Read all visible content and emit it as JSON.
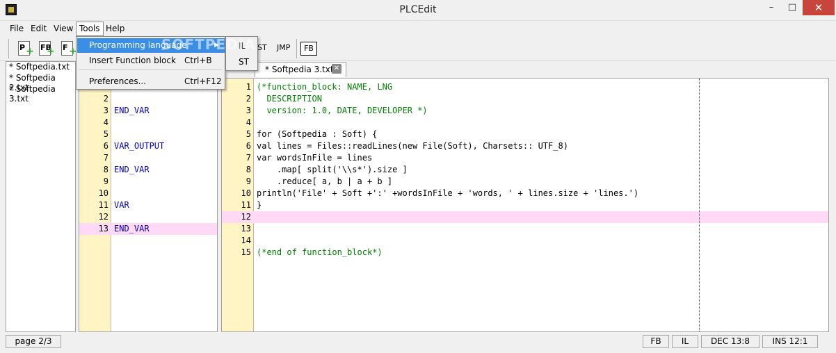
{
  "window": {
    "title": "PLCEdit",
    "minimize": "–",
    "maximize": "□",
    "close": "✕"
  },
  "menubar": {
    "file": "File",
    "edit": "Edit",
    "view": "View",
    "tools": "Tools",
    "help": "Help"
  },
  "toolbar": {
    "buttons": [
      {
        "label": "P",
        "icon": "new-program-icon"
      },
      {
        "label": "FB",
        "icon": "new-function-block-icon"
      },
      {
        "label": "F",
        "icon": "new-function-icon"
      }
    ],
    "st_label": "ST",
    "jmp_label": "JMP",
    "fb_label": "FB"
  },
  "tools_menu": {
    "programming_language": "Programming language",
    "insert_function_block": "Insert Function block",
    "insert_shortcut": "Ctrl+B",
    "preferences": "Preferences...",
    "preferences_shortcut": "Ctrl+F12",
    "submenu": [
      "IL",
      "ST"
    ]
  },
  "watermark": "SOFTPEDIA",
  "files": [
    "* Softpedia.txt",
    "* Softpedia 2.txt",
    "* Softpedia 3.txt"
  ],
  "tab": {
    "label": "* Softpedia 3.txt",
    "close": "✕"
  },
  "left_editor": {
    "lines": [
      {
        "n": "2",
        "text": "",
        "cls": "kw"
      },
      {
        "n": "3",
        "text": "END_VAR",
        "cls": "kw"
      },
      {
        "n": "4",
        "text": "",
        "cls": "kw"
      },
      {
        "n": "5",
        "text": "",
        "cls": "kw"
      },
      {
        "n": "6",
        "text": "VAR_OUTPUT",
        "cls": "kw"
      },
      {
        "n": "7",
        "text": "",
        "cls": "kw"
      },
      {
        "n": "8",
        "text": "END_VAR",
        "cls": "kw"
      },
      {
        "n": "9",
        "text": "",
        "cls": "kw"
      },
      {
        "n": "10",
        "text": "",
        "cls": "kw"
      },
      {
        "n": "11",
        "text": "VAR",
        "cls": "kw"
      },
      {
        "n": "12",
        "text": "",
        "cls": "kw"
      },
      {
        "n": "13",
        "text": "END_VAR",
        "cls": "kw",
        "highlight": true
      }
    ]
  },
  "right_editor": {
    "lines": [
      {
        "n": "1",
        "text": "(*function_block: NAME, LNG",
        "cls": "cm"
      },
      {
        "n": "2",
        "text": "  DESCRIPTION",
        "cls": "cm"
      },
      {
        "n": "3",
        "text": "  version: 1.0, DATE, DEVELOPER *)",
        "cls": "cm"
      },
      {
        "n": "4",
        "text": "",
        "cls": ""
      },
      {
        "n": "5",
        "text": "for (Softpedia : Soft) {",
        "cls": ""
      },
      {
        "n": "6",
        "text": "val lines = Files::readLines(new File(Soft), Charsets:: UTF_8)",
        "cls": ""
      },
      {
        "n": "7",
        "text": "var wordsInFile = lines",
        "cls": ""
      },
      {
        "n": "8",
        "text": "    .map[ split('\\\\s*').size ]",
        "cls": ""
      },
      {
        "n": "9",
        "text": "    .reduce[ a, b | a + b ]",
        "cls": ""
      },
      {
        "n": "10",
        "text": "println('File' + Soft +':' +wordsInFile + 'words, ' + lines.size + 'lines.')",
        "cls": ""
      },
      {
        "n": "11",
        "text": "}",
        "cls": ""
      },
      {
        "n": "12",
        "text": "",
        "cls": "",
        "highlight": true
      },
      {
        "n": "13",
        "text": "",
        "cls": ""
      },
      {
        "n": "14",
        "text": "",
        "cls": ""
      },
      {
        "n": "15",
        "text": "(*end of function_block*)",
        "cls": "cm"
      }
    ]
  },
  "statusbar": {
    "page": "page 2/3",
    "lang1": "FB",
    "lang2": "IL",
    "position": "DEC 13:8",
    "mode": "INS 12:1"
  }
}
